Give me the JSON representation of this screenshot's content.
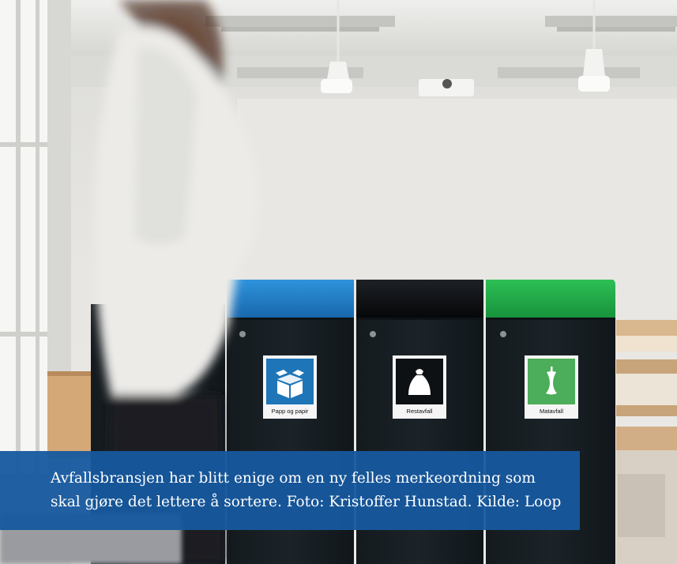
{
  "photo": {
    "bins": [
      {
        "label": "Papp og papir",
        "lid_color": "#1f7fcf",
        "icon": "cardboard-box-icon",
        "icon_bg": "#1e75b8"
      },
      {
        "label": "Restavfall",
        "lid_color": "#0c0f12",
        "icon": "trash-bag-icon",
        "icon_bg": "#0e1114"
      },
      {
        "label": "Matavfall",
        "lid_color": "#1fa84a",
        "icon": "apple-core-icon",
        "icon_bg": "#4cad5a"
      }
    ]
  },
  "caption": {
    "line1": "Avfallsbransjen har blitt enige om en ny felles merkeordning som",
    "line2": "skal gjøre det lettere å sortere. Foto: Kristoffer Hunstad. Kilde: Loop"
  }
}
